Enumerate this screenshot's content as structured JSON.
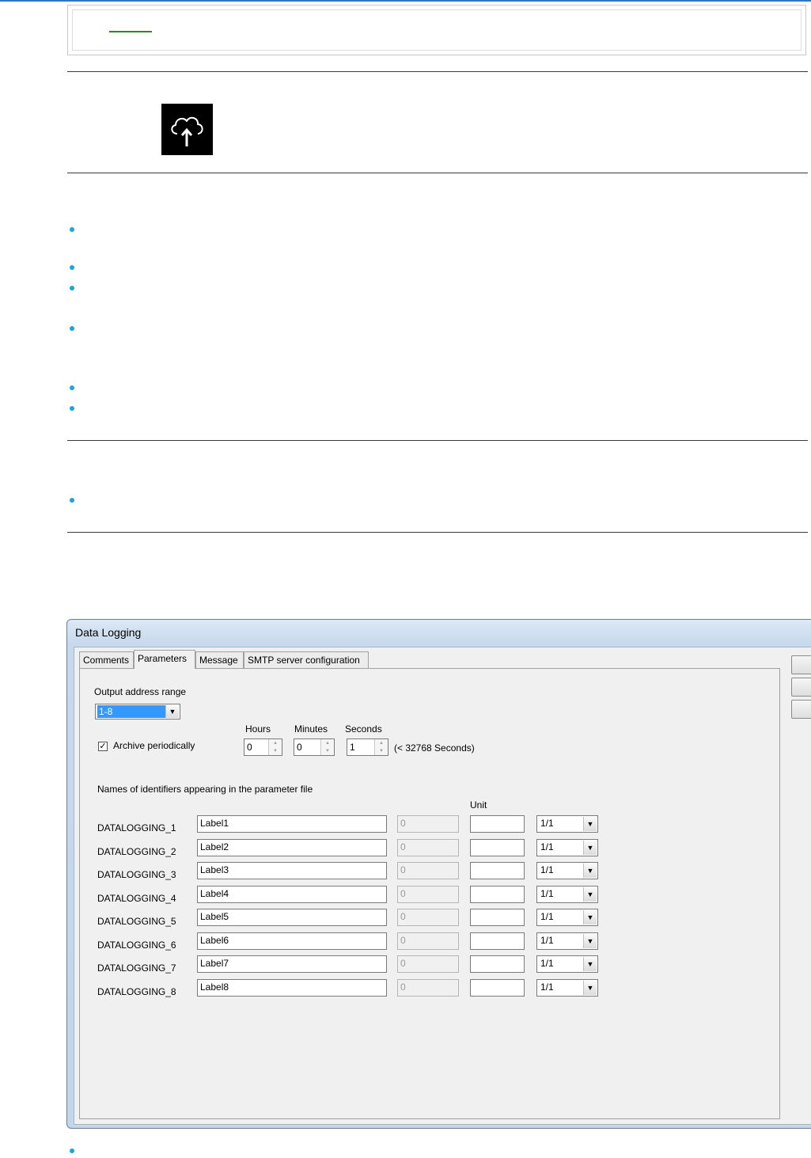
{
  "dialog": {
    "title": "Data Logging",
    "tabs": [
      "Comments",
      "Parameters",
      "Message",
      "SMTP server configuration"
    ],
    "active_tab": "Parameters",
    "output_range_label": "Output address range",
    "output_range_value": "1-8",
    "archive_label": "Archive periodically",
    "archive_checked": "✓",
    "hours_label": "Hours",
    "minutes_label": "Minutes",
    "seconds_label": "Seconds",
    "hours_value": "0",
    "minutes_value": "0",
    "seconds_value": "1",
    "seconds_hint": "(< 32768 Seconds)",
    "identifiers_label": "Names of identifiers appearing in the parameter file",
    "unit_label": "Unit",
    "rows": [
      {
        "id": "DATALOGGING_1",
        "label": "Label1",
        "value": "0",
        "unit": "",
        "ratio": "1/1"
      },
      {
        "id": "DATALOGGING_2",
        "label": "Label2",
        "value": "0",
        "unit": "",
        "ratio": "1/1"
      },
      {
        "id": "DATALOGGING_3",
        "label": "Label3",
        "value": "0",
        "unit": "",
        "ratio": "1/1"
      },
      {
        "id": "DATALOGGING_4",
        "label": "Label4",
        "value": "0",
        "unit": "",
        "ratio": "1/1"
      },
      {
        "id": "DATALOGGING_5",
        "label": "Label5",
        "value": "0",
        "unit": "",
        "ratio": "1/1"
      },
      {
        "id": "DATALOGGING_6",
        "label": "Label6",
        "value": "0",
        "unit": "",
        "ratio": "1/1"
      },
      {
        "id": "DATALOGGING_7",
        "label": "Label7",
        "value": "0",
        "unit": "",
        "ratio": "1/1"
      },
      {
        "id": "DATALOGGING_8",
        "label": "Label8",
        "value": "0",
        "unit": "",
        "ratio": "1/1"
      }
    ]
  },
  "icons": {
    "upload": "cloud-upload-icon",
    "bullet": "bullet-icon"
  },
  "colors": {
    "accent": "#2a78c2",
    "bullet": "#1aa6d8",
    "link": "#2b8a2b",
    "selection": "#3399ff"
  }
}
